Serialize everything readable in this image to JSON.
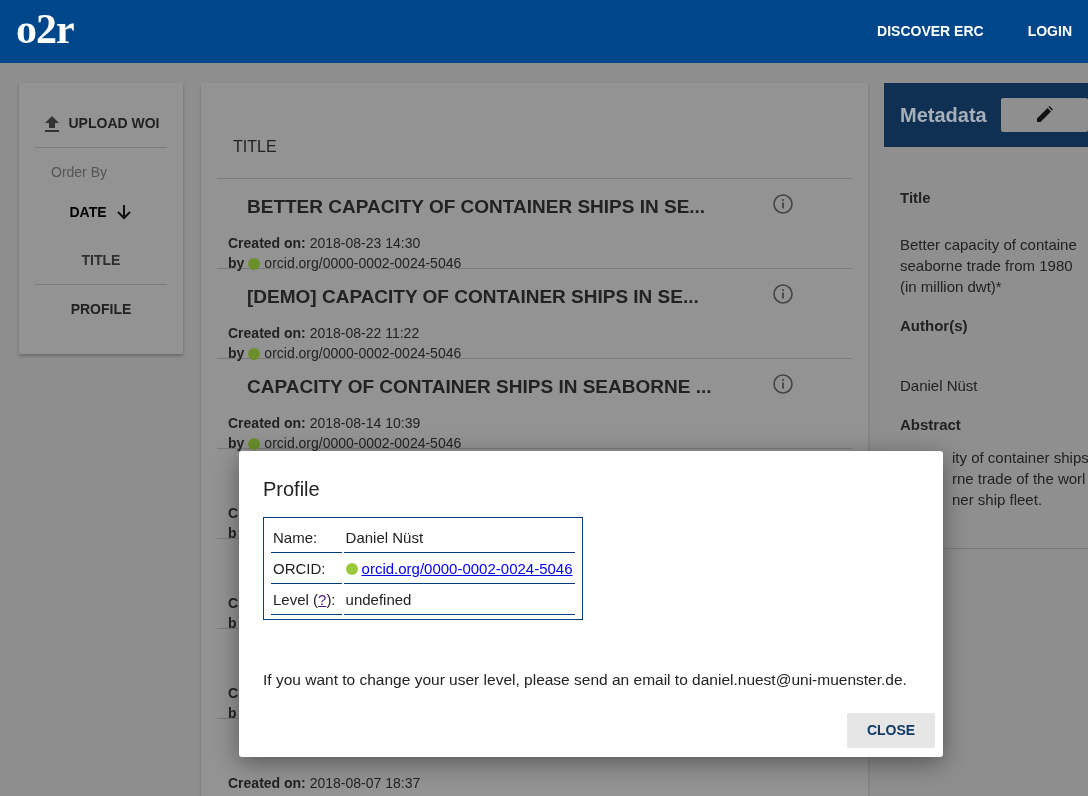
{
  "header": {
    "logo": "o2r",
    "nav": [
      "DISCOVER ERC",
      "LOGIN"
    ]
  },
  "sidebar": {
    "upload_button": "UPLOAD WOI",
    "order_by_label": "Order By",
    "sort_options": [
      {
        "label": "DATE",
        "selected": true
      },
      {
        "label": "TITLE",
        "selected": false
      }
    ],
    "profile_button": "PROFILE"
  },
  "list": {
    "column_header": "TITLE",
    "items": [
      {
        "title": "BETTER CAPACITY OF CONTAINER SHIPS IN SE...",
        "created_label": "Created on:",
        "created": "2018-08-23 14:30",
        "by_label": "by",
        "author": "orcid.org/0000-0002-0024-5046"
      },
      {
        "title": "[DEMO] CAPACITY OF CONTAINER SHIPS IN SE...",
        "created_label": "Created on:",
        "created": "2018-08-22 11:22",
        "by_label": "by",
        "author": "orcid.org/0000-0002-0024-5046"
      },
      {
        "title": "CAPACITY OF CONTAINER SHIPS IN SEABORNE ...",
        "created_label": "Created on:",
        "created": "2018-08-14 10:39",
        "by_label": "by",
        "author": "orcid.org/0000-0002-0024-5046"
      },
      {
        "created_label": "C",
        "by_label": "b"
      },
      {
        "created_label": "C",
        "by_label": "b"
      },
      {
        "created_label": "C",
        "by_label": "b"
      },
      {
        "created_label": "Created on:",
        "created": "2018-08-07 18:37"
      }
    ]
  },
  "metadata": {
    "title": "Metadata",
    "sections": [
      {
        "heading": "Title",
        "lines": [
          "Better capacity of containe",
          "seaborne trade from 1980",
          "(in million dwt)*"
        ]
      },
      {
        "heading": "Author(s)",
        "lines": [
          "Daniel Nüst"
        ]
      },
      {
        "heading": "Abstract",
        "lines": [
          "ity of container ships",
          "rne trade of the worl",
          "ner ship fleet."
        ]
      }
    ]
  },
  "dialog": {
    "title": "Profile",
    "fields": [
      {
        "kind": "text",
        "label": "Name:",
        "value": "Daniel Nüst"
      },
      {
        "kind": "orcid",
        "label": "ORCID:",
        "value": "orcid.org/0000-0002-0024-5046"
      },
      {
        "kind": "help",
        "label_before": "Level (",
        "help_link": "?",
        "label_after": "):",
        "value": "undefined"
      }
    ],
    "message": "If you want to change your user level, please send an email to daniel.nuest@uni-muenster.de.",
    "close_button": "CLOSE"
  }
}
